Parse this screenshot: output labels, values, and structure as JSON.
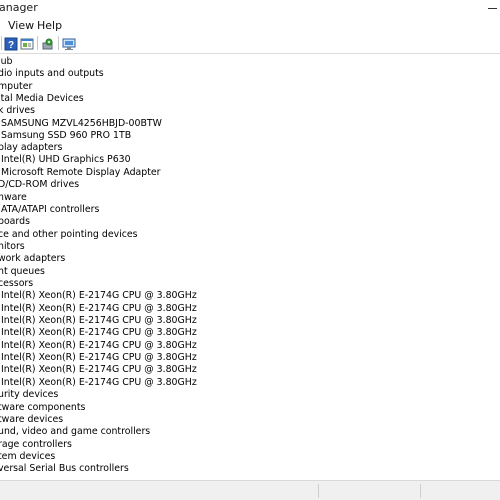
{
  "window": {
    "title": "anager"
  },
  "menu": [
    {
      "label": "View"
    },
    {
      "label": "Help"
    }
  ],
  "toolbar": {
    "icons": [
      "help-icon",
      "properties-icon",
      "update-driver-icon",
      "scan-hardware-icon"
    ]
  },
  "tree": {
    "items": [
      "lub",
      "dio inputs and outputs",
      "mputer",
      "ital Media Devices",
      "k drives",
      "SAMSUNG MZVL4256HBJD-00BTW",
      "Samsung SSD 960 PRO 1TB",
      "play adapters",
      "Intel(R) UHD Graphics P630",
      "Microsoft Remote Display Adapter",
      "D/CD-ROM drives",
      "nware",
      "ATA/ATAPI controllers",
      "boards",
      "ce and other pointing devices",
      "nitors",
      "work adapters",
      "nt queues",
      "cessors",
      "Intel(R) Xeon(R) E-2174G CPU @ 3.80GHz",
      "Intel(R) Xeon(R) E-2174G CPU @ 3.80GHz",
      "Intel(R) Xeon(R) E-2174G CPU @ 3.80GHz",
      "Intel(R) Xeon(R) E-2174G CPU @ 3.80GHz",
      "Intel(R) Xeon(R) E-2174G CPU @ 3.80GHz",
      "Intel(R) Xeon(R) E-2174G CPU @ 3.80GHz",
      "Intel(R) Xeon(R) E-2174G CPU @ 3.80GHz",
      "Intel(R) Xeon(R) E-2174G CPU @ 3.80GHz",
      "urity devices",
      "tware components",
      "tware devices",
      "und, video and game controllers",
      "rage controllers",
      "tem devices",
      "versal Serial Bus controllers"
    ]
  }
}
